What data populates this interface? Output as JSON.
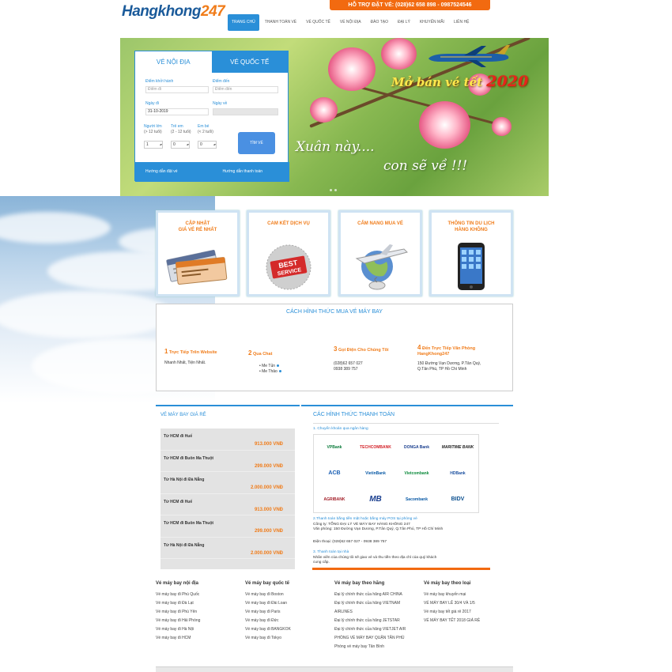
{
  "brand": {
    "name_main": "Hangkhong",
    "name_accent": "247"
  },
  "hotline": "HỖ TRỢ ĐẶT VÉ: (028)62 658 898 - 0987524546",
  "nav": [
    {
      "label": "Trang chủ",
      "active": true
    },
    {
      "label": "Thanh toán vé",
      "active": false
    },
    {
      "label": "Vé quốc tế",
      "active": false
    },
    {
      "label": "Vé nội địa",
      "active": false
    },
    {
      "label": "Đào tạo",
      "active": false
    },
    {
      "label": "Đại lý",
      "active": false
    },
    {
      "label": "Khuyến mãi",
      "active": false
    },
    {
      "label": "Liên hệ",
      "active": false
    }
  ],
  "banner": {
    "headline": "Mở bán vé tết",
    "year": "2020",
    "line1": "Xuân này....",
    "line2": "con sẽ về !!!"
  },
  "booking": {
    "tab_domestic": "Vé nội địa",
    "tab_international": "Vé quốc tế",
    "from_label": "Điểm khởi hành",
    "from_placeholder": "Điểm đi",
    "to_label": "Điểm đến",
    "to_placeholder": "Điểm đến",
    "depart_label": "Ngày đi",
    "depart_value": "31-10-2019",
    "return_label": "Ngày về",
    "adult_label": "Người lớn",
    "adult_hint": "(> 12 tuổi)",
    "adult_value": "1",
    "child_label": "Trẻ em",
    "child_hint": "(2 - 12 tuổi)",
    "child_value": "0",
    "infant_label": "Em bé",
    "infant_hint": "(< 2 tuổi)",
    "infant_value": "0",
    "search_label": "TÌM VÉ",
    "guide_booking": "Hướng dẫn đặt vé",
    "guide_payment": "Hướng dẫn thanh toán"
  },
  "features": [
    {
      "title1": "Cập nhật",
      "title2": "giá vé rẻ nhất"
    },
    {
      "title1": "Cam kết dịch vụ",
      "title2": ""
    },
    {
      "title1": "Cẩm nang mua vé",
      "title2": ""
    },
    {
      "title1": "Thông tin du lịch",
      "title2": "hàng không"
    }
  ],
  "purchase": {
    "title": "CÁCH HÌNH THỨC MUA VÉ MÁY BAY",
    "s1_num": "1",
    "s1_title": "Trực Tiếp Trên Website",
    "s1_text": "Nhanh Nhất, Tiện Nhất.",
    "s2_num": "2",
    "s2_title": "Qua Chat",
    "s2_item1": "Me Tủn",
    "s2_item2": "Me Thảo",
    "s3_num": "3",
    "s3_title": "Gọi Điện Cho Chúng Tôi",
    "s3_line1": "(028)62 657 027",
    "s3_line2": "0938 389 757",
    "s4_num": "4",
    "s4_title1": "Đến Trực Tiếp Văn Phòng",
    "s4_title2": "HangKhong247",
    "s4_line1": "150 Đường Vạn Dương, P.Tân Quý,",
    "s4_line2": "Q.Tân Phú, TP Hồ Chí Minh"
  },
  "cheap": {
    "title": "VÉ MÁY BAY GIÁ RẺ",
    "routes": [
      {
        "route": "Từ HCM đi Huế",
        "price": "913.000 VNĐ"
      },
      {
        "route": "Từ HCM đi Buôn Ma Thuột",
        "price": "299.000 VNĐ"
      },
      {
        "route": "Từ Hà Nội đi Đà Nẵng",
        "price": "2.000.000 VNĐ"
      },
      {
        "route": "Từ HCM đi Huế",
        "price": "913.000 VNĐ"
      },
      {
        "route": "Từ HCM đi Buôn Ma Thuột",
        "price": "299.000 VNĐ"
      },
      {
        "route": "Từ Hà Nội đi Đà Nẵng",
        "price": "2.000.000 VNĐ"
      }
    ]
  },
  "payment": {
    "title": "CÁC HÌNH THỨC THANH TOÁN",
    "m1": "1. Chuyển khoản qua ngân hàng",
    "banks": [
      "VPBank",
      "TECHCOMBANK",
      "DONGA Bank",
      "MARITIME BANK",
      "ACB",
      "VietinBank",
      "Vietcombank",
      "HDBank",
      "AGRIBANK",
      "MB",
      "Sacombank",
      "BIDV"
    ],
    "m2": "2.Thanh toán bằng tiền mặt hoặc bằng máy POS tại phòng vé",
    "m2_l1": "Công ty: TỔNG ĐẠI LÝ VÉ MÁY BAY HÀNG KHÔNG 247",
    "m2_l2": "Văn phòng: 150 Đường Vạn Dương, P.Tân Quý, Q.Tân Phú, TP Hồ Chí Minh",
    "m2_l3": "Điện thoại: (028)62 657 027 - 0938 389 757",
    "m3": "3. Thanh toán tại nhà",
    "m3_l1": "Nhân viên của chúng tôi sẽ giao vé và thu tiền theo địa chỉ của quý khách",
    "m3_l2": "cung cấp."
  },
  "footer": [
    {
      "heading": "Vé máy bay nội địa",
      "links": [
        "Vé máy bay đi Phú Quốc",
        "Vé máy bay đi Đà Lạt",
        "Vé máy bay đi Phú Yên",
        "Vé máy bay đi Hải Phòng",
        "Vé máy bay đi Hà Nội",
        "Vé máy bay đi HCM"
      ]
    },
    {
      "heading": "Vé máy bay quốc tế",
      "links": [
        "Vé máy bay đi Boston",
        "Vé máy bay đi Đài Loan",
        "Vé máy bay đi Paris",
        "Vé máy bay đi Đức",
        "Vé máy bay đi BANGKOK",
        "Vé máy bay đi Tokyo"
      ]
    },
    {
      "heading": "Vé máy bay theo hãng",
      "links": [
        "Đại lý chính thức của hãng AIR CHINA",
        "Đại lý chính thức của hãng VIETNAM",
        "AIRLINES",
        "Đại lý chính thức của hãng JETSTAR",
        "Đại lý chính thức của hãng VIETJET AIR",
        "PHÒNG VÉ MÁY BAY QUẬN TÂN PHÚ",
        "Phòng vé máy bay Tân Bình"
      ]
    },
    {
      "heading": "Vé máy bay theo loại",
      "links": [
        "Vé máy bay khuyến mại",
        "VÉ MÁY BAY LỄ 30/4 VÀ 1/5",
        "Vé máy bay tết giá rẻ 2017",
        "VÉ MÁY BAY TẾT 2018 GIÁ RẺ"
      ]
    }
  ],
  "colors": {
    "primary": "#2a8fd8",
    "accent": "#f07c1a",
    "hotline_bg": "#f26a10"
  }
}
